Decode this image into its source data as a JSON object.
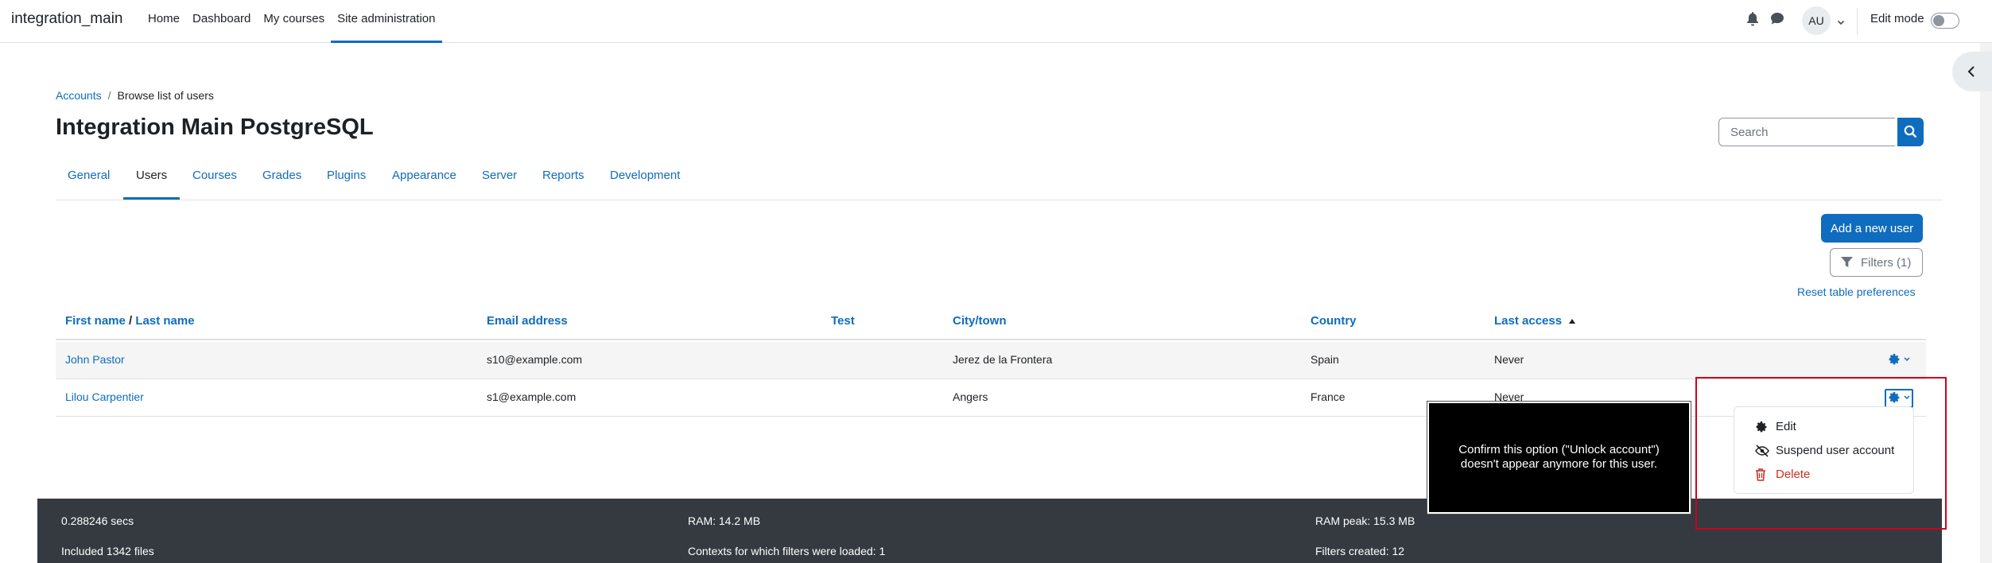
{
  "navbar": {
    "brand": "integration_main",
    "items": [
      {
        "label": "Home"
      },
      {
        "label": "Dashboard"
      },
      {
        "label": "My courses"
      },
      {
        "label": "Site administration"
      }
    ],
    "avatar_initials": "AU",
    "edit_mode_label": "Edit mode"
  },
  "breadcrumb": {
    "root": "Accounts",
    "current": "Browse list of users"
  },
  "page": {
    "title": "Integration Main PostgreSQL"
  },
  "search": {
    "placeholder": "Search"
  },
  "tabs": [
    {
      "label": "General"
    },
    {
      "label": "Users"
    },
    {
      "label": "Courses"
    },
    {
      "label": "Grades"
    },
    {
      "label": "Plugins"
    },
    {
      "label": "Appearance"
    },
    {
      "label": "Server"
    },
    {
      "label": "Reports"
    },
    {
      "label": "Development"
    }
  ],
  "actions": {
    "add_user": "Add a new user",
    "filters": "Filters (1)",
    "reset": "Reset table preferences"
  },
  "table": {
    "headers": {
      "first_name": "First name",
      "slash": "/",
      "last_name": "Last name",
      "email": "Email address",
      "test": "Test",
      "city": "City/town",
      "country": "Country",
      "last_access": "Last access"
    },
    "rows": [
      {
        "name": "John Pastor",
        "email": "s10@example.com",
        "city": "Jerez de la Frontera",
        "country": "Spain",
        "last_access": "Never"
      },
      {
        "name": "Lilou Carpentier",
        "email": "s1@example.com",
        "city": "Angers",
        "country": "France",
        "last_access": "Never"
      }
    ]
  },
  "action_menu": {
    "items": [
      {
        "label": "Edit",
        "icon": "gear-icon"
      },
      {
        "label": "Suspend user account",
        "icon": "eye-slash-icon"
      },
      {
        "label": "Delete",
        "icon": "trash-icon"
      }
    ]
  },
  "tooltip": {
    "text": "Confirm this option (\"Unlock account\") doesn't appear anymore for this user."
  },
  "footer": {
    "time": "0.288246 secs",
    "ram": "RAM: 14.2 MB",
    "ram_peak": "RAM peak: 15.3 MB",
    "files": "Included 1342 files",
    "contexts": "Contexts for which filters were loaded: 1",
    "filters": "Filters created: 12"
  },
  "colors": {
    "primary": "#0f6cbf",
    "danger": "#ca3120",
    "footer_bg": "#343a40",
    "highlight": "#d0021b"
  }
}
